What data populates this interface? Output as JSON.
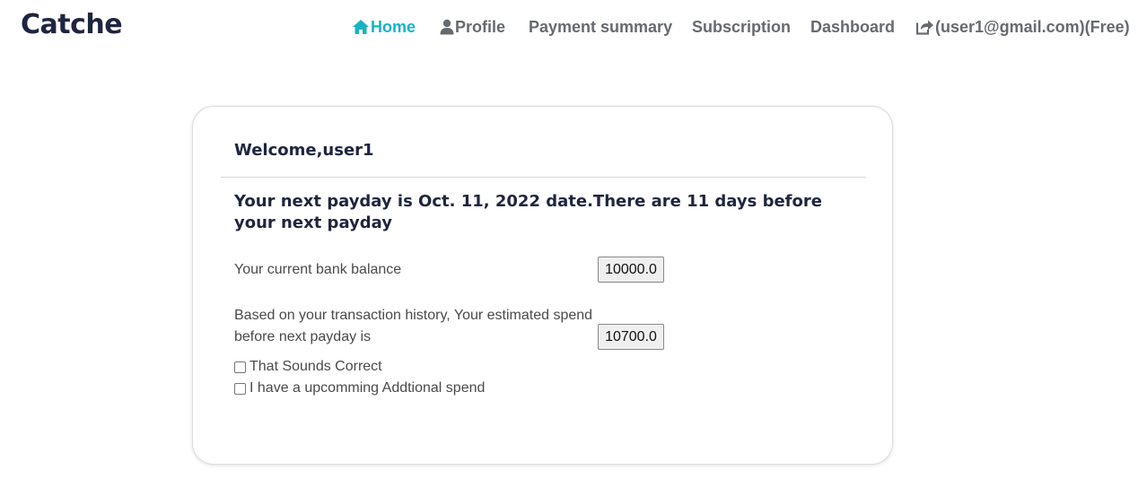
{
  "brand": "Catche",
  "nav": {
    "home": "Home",
    "profile": "Profile",
    "payment_summary": "Payment summary",
    "subscription": "Subscription",
    "dashboard": "Dashboard",
    "account": "(user1@gmail.com)(Free)"
  },
  "colors": {
    "accent": "#17b3c4",
    "heading": "#1f2540",
    "nav_text": "#666a70"
  },
  "card": {
    "title": "Welcome,user1",
    "payday_message": "Your next payday is Oct. 11, 2022 date.There are 11 days before your next payday",
    "balance_label": "Your current bank balance",
    "balance_value": "10000.0",
    "spend_label": "Based on your transaction history, Your estimated spend before next payday is",
    "spend_value": "10700.0",
    "checkbox1_label": "That Sounds Correct",
    "checkbox2_label": "I have a upcomming Addtional spend"
  }
}
